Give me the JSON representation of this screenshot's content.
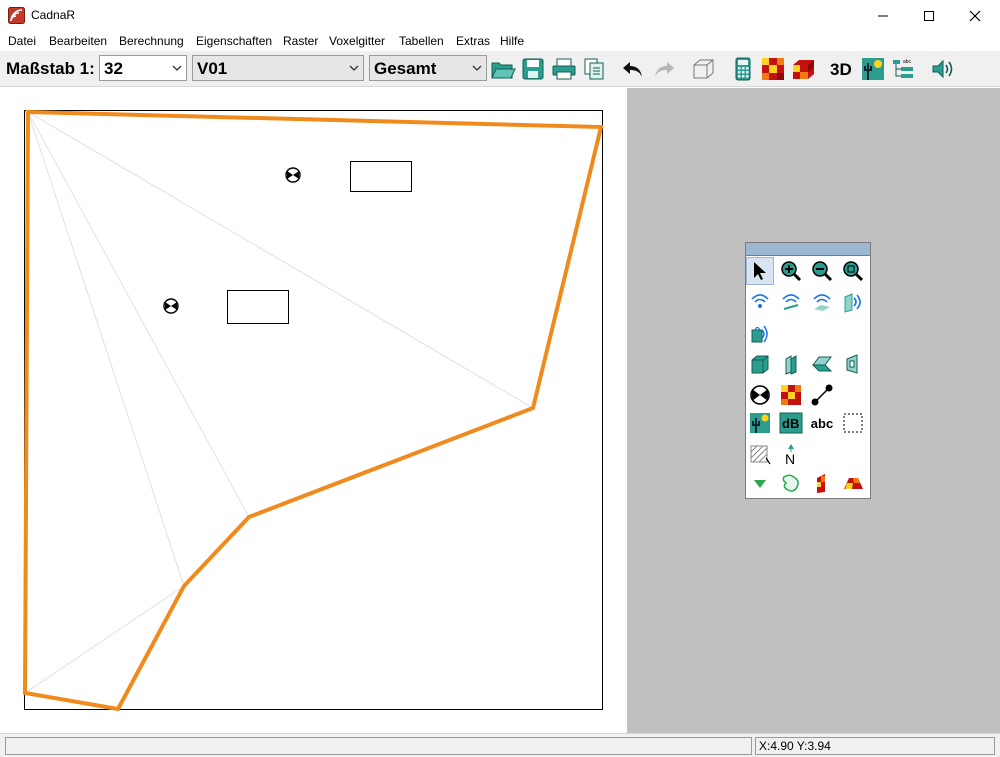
{
  "window": {
    "title": "CadnaR"
  },
  "menu": [
    {
      "label": "Datei"
    },
    {
      "label": "Bearbeiten"
    },
    {
      "label": "Berechnung"
    },
    {
      "label": "Eigenschaften"
    },
    {
      "label": "Raster"
    },
    {
      "label": "Voxelgitter"
    },
    {
      "label": "Tabellen"
    },
    {
      "label": "Extras"
    },
    {
      "label": "Hilfe"
    }
  ],
  "toolbar": {
    "scale_label": "Maßstab 1:",
    "scale_value": "32",
    "variant_value": "V01",
    "group_value": "Gesamt",
    "three_d_label": "3D",
    "icons": [
      "open-folder-icon",
      "save-icon",
      "print-icon",
      "copy-icon",
      "undo-icon",
      "redo-icon",
      "box-3d-icon",
      "calculator-icon",
      "grid-map-icon",
      "grid-3d-icon",
      "3d-view-button",
      "terrain-icon",
      "tree-icon",
      "speaker-icon"
    ]
  },
  "palette": {
    "dB_label": "dB",
    "abc_label": "abc",
    "north_label": "N",
    "tools": [
      "pointer",
      "zoom-in",
      "zoom-out",
      "zoom-fit",
      "point-source",
      "line-source",
      "area-source",
      "vertical-area-source",
      "sound-box",
      "wall",
      "absorber",
      "diffuser",
      "window-element",
      "receiver",
      "grid",
      "measure-line",
      "terrain",
      "db-label",
      "text-label",
      "selection-box",
      "hatch-area",
      "north-arrow",
      "triangle-marker",
      "outline-area",
      "facade-grid",
      "building-grid"
    ]
  },
  "colors": {
    "room_outline": "#f08a1c",
    "palette_header": "#9bb7d4",
    "gray_workspace": "#c0c0c0",
    "teal_icon": "#2a9d8f",
    "blue_icon": "#1a73e8"
  },
  "status": {
    "coords": "X:4.90 Y:3.94"
  }
}
